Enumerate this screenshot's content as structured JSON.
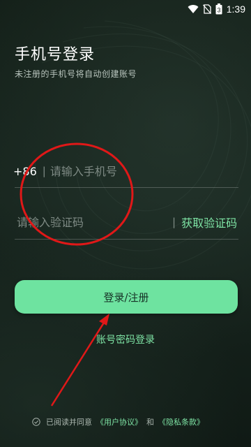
{
  "status_bar": {
    "time": "1:39",
    "battery_level": "3",
    "icons": [
      "wifi-icon",
      "no-sim-icon",
      "battery-icon"
    ]
  },
  "page": {
    "title": "手机号登录",
    "subtitle": "未注册的手机号将自动创建账号"
  },
  "phone_field": {
    "country_code": "+86",
    "divider": "|",
    "placeholder": "请输入手机号",
    "value": ""
  },
  "code_field": {
    "placeholder": "请输入验证码",
    "value": "",
    "divider": "|",
    "get_code_label": "获取验证码"
  },
  "login_button": {
    "label": "登录/注册"
  },
  "password_login": {
    "label": "账号密码登录"
  },
  "agreement": {
    "prefix": "已阅读并同意",
    "user_agreement": "《用户协议》",
    "conjunction": "和",
    "privacy_policy": "《隐私条款》",
    "checked": false
  },
  "colors": {
    "accent": "#6ee3a0",
    "link": "#7ee3a4",
    "annotation": "#e01818",
    "background": "#18261f"
  }
}
